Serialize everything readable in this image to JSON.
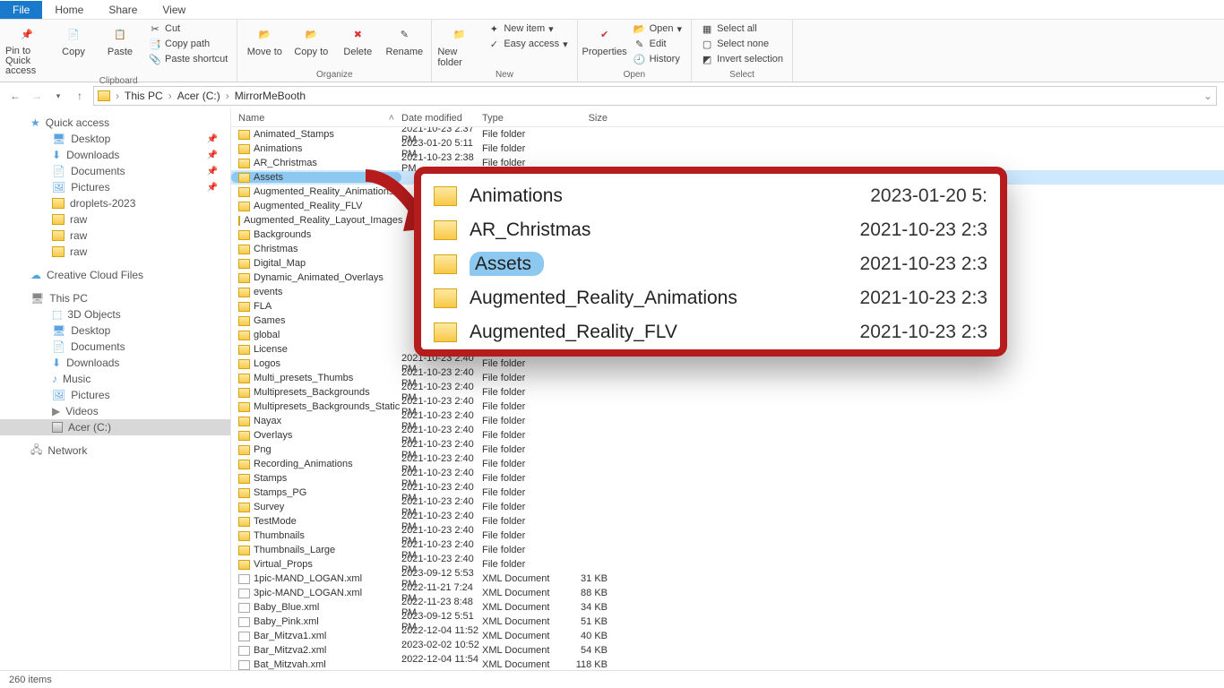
{
  "menu": {
    "file": "File",
    "home": "Home",
    "share": "Share",
    "view": "View"
  },
  "ribbon": {
    "pin": "Pin to Quick access",
    "copy": "Copy",
    "paste": "Paste",
    "cut": "Cut",
    "copypath": "Copy path",
    "pasteshort": "Paste shortcut",
    "clipboard": "Clipboard",
    "moveto": "Move to",
    "copyto": "Copy to",
    "delete": "Delete",
    "rename": "Rename",
    "organize": "Organize",
    "newfolder": "New folder",
    "newitem": "New item",
    "easyaccess": "Easy access",
    "new": "New",
    "properties": "Properties",
    "open": "Open",
    "edit": "Edit",
    "history": "History",
    "open_grp": "Open",
    "selectall": "Select all",
    "selectnone": "Select none",
    "invertsel": "Invert selection",
    "select": "Select"
  },
  "breadcrumb": {
    "thispc": "This PC",
    "drive": "Acer (C:)",
    "folder": "MirrorMeBooth"
  },
  "sidebar": {
    "quick": "Quick access",
    "desktop": "Desktop",
    "downloads": "Downloads",
    "documents": "Documents",
    "pictures": "Pictures",
    "droplets": "droplets-2023",
    "raw": "raw",
    "ccf": "Creative Cloud Files",
    "thispc": "This PC",
    "obj3d": "3D Objects",
    "music": "Music",
    "videos": "Videos",
    "acer": "Acer (C:)",
    "network": "Network"
  },
  "cols": {
    "name": "Name",
    "date": "Date modified",
    "type": "Type",
    "size": "Size"
  },
  "files": [
    {
      "n": "Animated_Stamps",
      "d": "2021-10-23 2:37 PM",
      "t": "File folder",
      "s": "",
      "f": true
    },
    {
      "n": "Animations",
      "d": "2023-01-20 5:11 PM",
      "t": "File folder",
      "s": "",
      "f": true
    },
    {
      "n": "AR_Christmas",
      "d": "2021-10-23 2:38 PM",
      "t": "File folder",
      "s": "",
      "f": true
    },
    {
      "n": "Assets",
      "d": "",
      "t": "",
      "s": "",
      "f": true,
      "sel": true
    },
    {
      "n": "Augmented_Reality_Animations",
      "d": "",
      "t": "",
      "s": "",
      "f": true
    },
    {
      "n": "Augmented_Reality_FLV",
      "d": "",
      "t": "",
      "s": "",
      "f": true
    },
    {
      "n": "Augmented_Reality_Layout_Images",
      "d": "",
      "t": "",
      "s": "",
      "f": true
    },
    {
      "n": "Backgrounds",
      "d": "",
      "t": "",
      "s": "",
      "f": true
    },
    {
      "n": "Christmas",
      "d": "",
      "t": "",
      "s": "",
      "f": true
    },
    {
      "n": "Digital_Map",
      "d": "",
      "t": "",
      "s": "",
      "f": true
    },
    {
      "n": "Dynamic_Animated_Overlays",
      "d": "",
      "t": "",
      "s": "",
      "f": true
    },
    {
      "n": "events",
      "d": "",
      "t": "",
      "s": "",
      "f": true
    },
    {
      "n": "FLA",
      "d": "",
      "t": "",
      "s": "",
      "f": true
    },
    {
      "n": "Games",
      "d": "",
      "t": "",
      "s": "",
      "f": true
    },
    {
      "n": "global",
      "d": "",
      "t": "",
      "s": "",
      "f": true
    },
    {
      "n": "License",
      "d": "",
      "t": "",
      "s": "",
      "f": true
    },
    {
      "n": "Logos",
      "d": "2021-10-23 2:40 PM",
      "t": "File folder",
      "s": "",
      "f": true
    },
    {
      "n": "Multi_presets_Thumbs",
      "d": "2021-10-23 2:40 PM",
      "t": "File folder",
      "s": "",
      "f": true
    },
    {
      "n": "Multipresets_Backgrounds",
      "d": "2021-10-23 2:40 PM",
      "t": "File folder",
      "s": "",
      "f": true
    },
    {
      "n": "Multipresets_Backgrounds_Static",
      "d": "2021-10-23 2:40 PM",
      "t": "File folder",
      "s": "",
      "f": true
    },
    {
      "n": "Nayax",
      "d": "2021-10-23 2:40 PM",
      "t": "File folder",
      "s": "",
      "f": true
    },
    {
      "n": "Overlays",
      "d": "2021-10-23 2:40 PM",
      "t": "File folder",
      "s": "",
      "f": true
    },
    {
      "n": "Png",
      "d": "2021-10-23 2:40 PM",
      "t": "File folder",
      "s": "",
      "f": true
    },
    {
      "n": "Recording_Animations",
      "d": "2021-10-23 2:40 PM",
      "t": "File folder",
      "s": "",
      "f": true
    },
    {
      "n": "Stamps",
      "d": "2021-10-23 2:40 PM",
      "t": "File folder",
      "s": "",
      "f": true
    },
    {
      "n": "Stamps_PG",
      "d": "2021-10-23 2:40 PM",
      "t": "File folder",
      "s": "",
      "f": true
    },
    {
      "n": "Survey",
      "d": "2021-10-23 2:40 PM",
      "t": "File folder",
      "s": "",
      "f": true
    },
    {
      "n": "TestMode",
      "d": "2021-10-23 2:40 PM",
      "t": "File folder",
      "s": "",
      "f": true
    },
    {
      "n": "Thumbnails",
      "d": "2021-10-23 2:40 PM",
      "t": "File folder",
      "s": "",
      "f": true
    },
    {
      "n": "Thumbnails_Large",
      "d": "2021-10-23 2:40 PM",
      "t": "File folder",
      "s": "",
      "f": true
    },
    {
      "n": "Virtual_Props",
      "d": "2021-10-23 2:40 PM",
      "t": "File folder",
      "s": "",
      "f": true
    },
    {
      "n": "1pic-MAND_LOGAN.xml",
      "d": "2023-09-12 5:53 PM",
      "t": "XML Document",
      "s": "31 KB",
      "f": false
    },
    {
      "n": "3pic-MAND_LOGAN.xml",
      "d": "2022-11-21 7:24 PM",
      "t": "XML Document",
      "s": "88 KB",
      "f": false
    },
    {
      "n": "Baby_Blue.xml",
      "d": "2022-11-23 8:48 PM",
      "t": "XML Document",
      "s": "34 KB",
      "f": false
    },
    {
      "n": "Baby_Pink.xml",
      "d": "2023-09-12 5:51 PM",
      "t": "XML Document",
      "s": "51 KB",
      "f": false
    },
    {
      "n": "Bar_Mitzva1.xml",
      "d": "2022-12-04 11:52 ...",
      "t": "XML Document",
      "s": "40 KB",
      "f": false
    },
    {
      "n": "Bar_Mitzva2.xml",
      "d": "2023-02-02 10:52 ...",
      "t": "XML Document",
      "s": "54 KB",
      "f": false
    },
    {
      "n": "Bat_Mitzvah.xml",
      "d": "2022-12-04 11:54 ...",
      "t": "XML Document",
      "s": "118 KB",
      "f": false
    }
  ],
  "callout": {
    "rows": [
      {
        "n": "Animations",
        "d": "2023-01-20 5:"
      },
      {
        "n": "AR_Christmas",
        "d": "2021-10-23 2:3"
      },
      {
        "n": "Assets",
        "d": "2021-10-23 2:3",
        "sel": true
      },
      {
        "n": "Augmented_Reality_Animations",
        "d": "2021-10-23 2:3"
      },
      {
        "n": "Augmented_Reality_FLV",
        "d": "2021-10-23 2:3"
      }
    ]
  },
  "status": {
    "items": "260 items"
  }
}
